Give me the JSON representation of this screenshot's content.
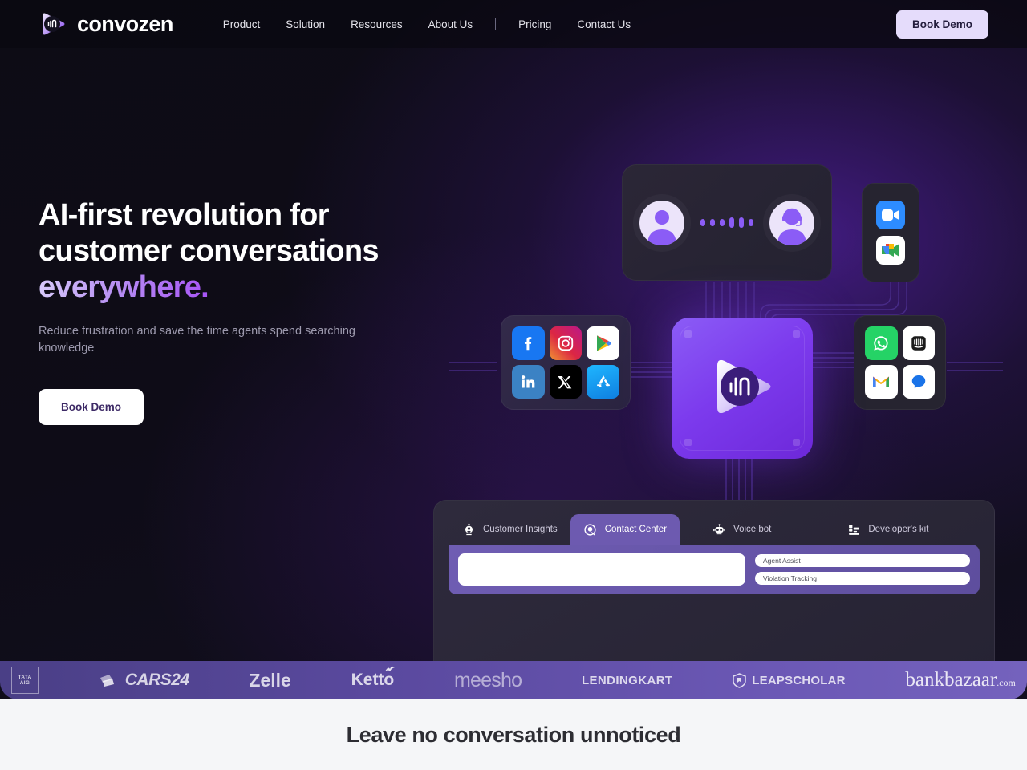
{
  "brand": {
    "name": "convozen",
    "logo_icon": "convozen-waveform-logo"
  },
  "nav": {
    "links": [
      {
        "label": "Product"
      },
      {
        "label": "Solution"
      },
      {
        "label": "Resources"
      },
      {
        "label": "About Us"
      }
    ],
    "separator": "|",
    "links_right": [
      {
        "label": "Pricing"
      },
      {
        "label": "Contact Us"
      }
    ],
    "cta_label": "Book Demo"
  },
  "hero": {
    "title_line1": "AI-first revolution for",
    "title_line2": "customer conversations",
    "title_accent": "everywhere.",
    "subtitle": "Reduce frustration and save the time agents spend searching knowledge",
    "cta_label": "Book Demo"
  },
  "art": {
    "conversation": {
      "customer_icon": "user-avatar-icon",
      "agent_icon": "headset-agent-avatar-icon",
      "connector": "transmission-dots"
    },
    "video_apps": [
      {
        "name": "zoom-icon",
        "color": "#2d8cff"
      },
      {
        "name": "google-meet-icon",
        "color": "#ffffff"
      }
    ],
    "social_apps": [
      {
        "name": "facebook-icon",
        "color": "#1877f2"
      },
      {
        "name": "instagram-icon",
        "color": "#e1306c"
      },
      {
        "name": "google-play-icon",
        "color": "#ffffff"
      },
      {
        "name": "linkedin-icon",
        "color": "#0a66c2"
      },
      {
        "name": "x-twitter-icon",
        "color": "#000000"
      },
      {
        "name": "app-store-icon",
        "color": "#1e9bf0"
      }
    ],
    "messaging_apps": [
      {
        "name": "whatsapp-icon",
        "color": "#25d366"
      },
      {
        "name": "intercom-icon",
        "color": "#ffffff"
      },
      {
        "name": "gmail-icon",
        "color": "#ffffff"
      },
      {
        "name": "google-messages-icon",
        "color": "#ffffff"
      }
    ],
    "chip": {
      "icon": "convozen-chip-logo",
      "color": "#7c3aed"
    }
  },
  "tabs_card": {
    "tabs": [
      {
        "label": "Customer Insights",
        "icon": "customer-insights-icon",
        "active": false
      },
      {
        "label": "Contact Center",
        "icon": "contact-center-icon",
        "active": true
      },
      {
        "label": "Voice bot",
        "icon": "robot-icon",
        "active": false
      },
      {
        "label": "Developer's kit",
        "icon": "developer-kit-icon",
        "active": false
      }
    ],
    "panel": {
      "preview_placeholder": "",
      "features": [
        {
          "label": "Agent Assist"
        },
        {
          "label": "Violation Tracking"
        }
      ]
    }
  },
  "logos": [
    {
      "name": "tata-aig-logo",
      "line1": "TATA",
      "line2": "AIG"
    },
    {
      "name": "cars24-logo",
      "label": "CARS24"
    },
    {
      "name": "zelle-logo",
      "label": "Zelle"
    },
    {
      "name": "ketto-logo",
      "label": "Ketto"
    },
    {
      "name": "meesho-logo",
      "label": "meesho"
    },
    {
      "name": "lendingkart-logo",
      "label": "LENDINGKART"
    },
    {
      "name": "leapscholar-logo",
      "label_light": "LEAP",
      "label_bold": "SCHOLAR"
    },
    {
      "name": "bankbazaar-logo",
      "label": "bankbazaar",
      "suffix": ".com"
    }
  ],
  "below_fold": {
    "heading": "Leave no conversation unnoticed"
  },
  "colors": {
    "accent_purple": "#7c3aed",
    "accent_light": "#d7c9fb",
    "bg_dark": "#0d0c15",
    "strip": "#5b4aa0"
  }
}
